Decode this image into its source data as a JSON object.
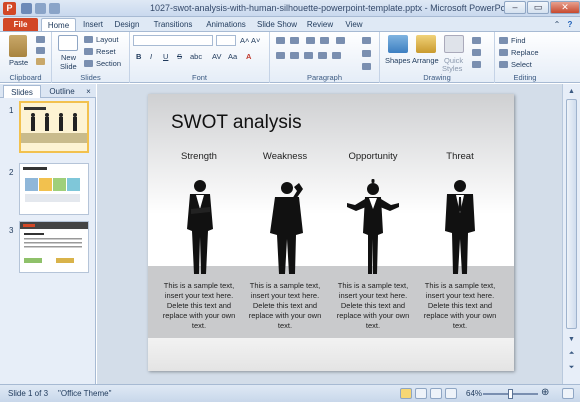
{
  "window": {
    "title": "1027-swot-analysis-with-human-silhouette-powerpoint-template.pptx - Microsoft PowerPoint",
    "logo_letter": "P"
  },
  "ribbon": {
    "tabs": [
      "File",
      "Home",
      "Insert",
      "Design",
      "Transitions",
      "Animations",
      "Slide Show",
      "Review",
      "View"
    ],
    "clipboard": {
      "paste": "Paste",
      "group": "Clipboard"
    },
    "slides": {
      "new_slide": "New",
      "new_slide2": "Slide",
      "layout": "Layout",
      "reset": "Reset",
      "section": "Section",
      "group": "Slides"
    },
    "font": {
      "bold": "B",
      "italic": "I",
      "underline": "U",
      "strike": "S",
      "shadow": "abc",
      "group": "Font"
    },
    "paragraph": {
      "group": "Paragraph"
    },
    "drawing": {
      "shapes": "Shapes",
      "arrange": "Arrange",
      "quick_styles": "Quick",
      "quick_styles2": "Styles",
      "group": "Drawing"
    },
    "editing": {
      "find": "Find",
      "replace": "Replace",
      "select": "Select",
      "group": "Editing"
    }
  },
  "left_pane": {
    "tab_slides": "Slides",
    "tab_outline": "Outline",
    "close": "×",
    "thumbs": [
      {
        "num": "1"
      },
      {
        "num": "2"
      },
      {
        "num": "3"
      }
    ]
  },
  "slide": {
    "title": "SWOT analysis",
    "columns": [
      {
        "heading": "Strength",
        "body": "This is a sample text, insert your text here. Delete this text and replace with your own text."
      },
      {
        "heading": "Weakness",
        "body": "This is a sample text, insert your text here. Delete this text and replace with your own text."
      },
      {
        "heading": "Opportunity",
        "body": "This is a sample text, insert your text here. Delete this text and replace with your own text."
      },
      {
        "heading": "Threat",
        "body": "This is a sample text, insert your text here. Delete this text and replace with your own text."
      }
    ]
  },
  "status": {
    "slide_count": "Slide 1 of 3",
    "theme": "\"Office Theme\"",
    "zoom": "64%"
  },
  "colors": {
    "file_tab": "#d24726",
    "ribbon_bg": "#dfe9f5",
    "selected_thumb": "#f2c14e"
  }
}
